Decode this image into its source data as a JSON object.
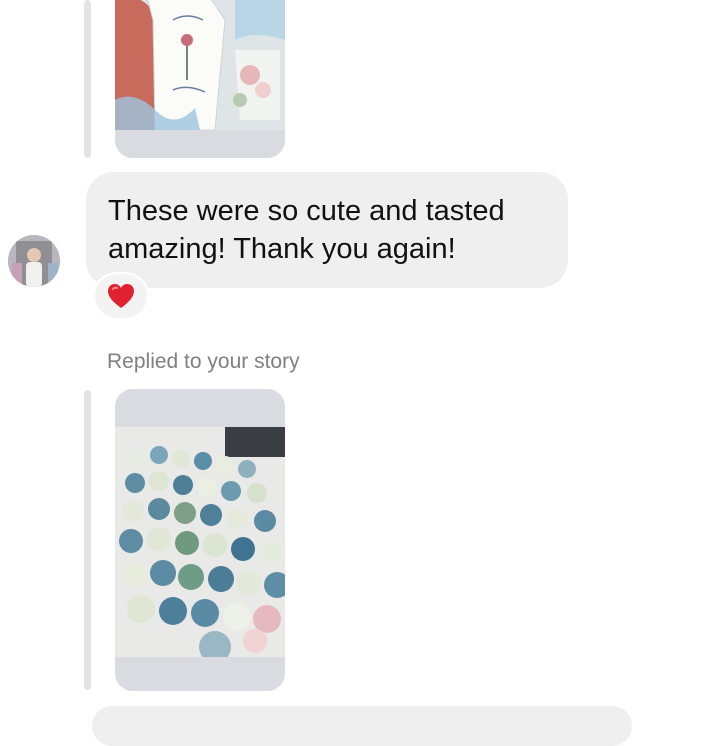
{
  "thread": {
    "message": {
      "text": "These were so cute and tasted amazing! Thank you again!",
      "reaction": "heart-emoji"
    },
    "story_reply": {
      "label": "Replied to your story"
    }
  },
  "icons": {
    "avatar": "user-avatar",
    "reaction": "red-heart-icon"
  },
  "colors": {
    "bubble": "#efefef",
    "reply_bar": "#e4e4e6",
    "story_frame": "#d9dbe0",
    "meta_text": "#7f7f84",
    "heart": "#e0212f"
  }
}
